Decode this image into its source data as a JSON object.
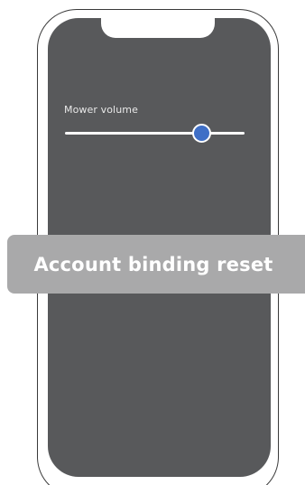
{
  "settings": {
    "volume_label": "Mower volume",
    "volume_level": 0.76
  },
  "toast": {
    "message": "Account binding reset"
  },
  "colors": {
    "screen_background": "#58595b",
    "slider_thumb": "#3f6fc6",
    "toast_background": "#a9a9aa"
  }
}
